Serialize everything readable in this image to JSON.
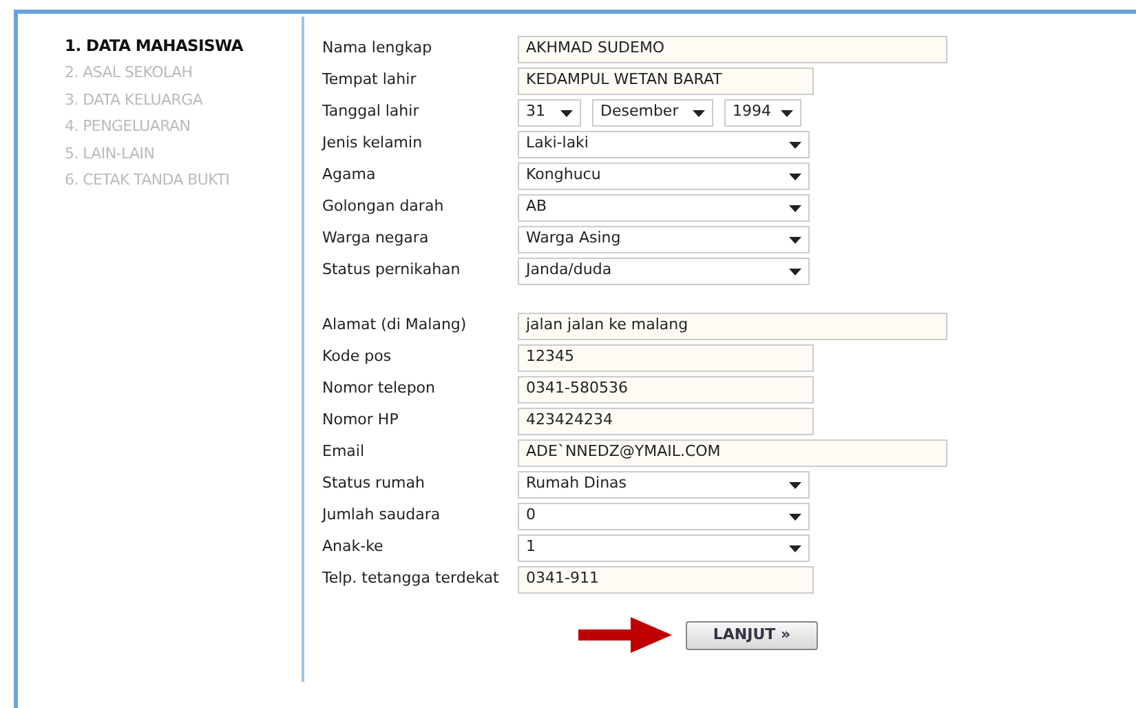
{
  "steps": [
    {
      "label": "1. DATA MAHASISWA",
      "selected": true
    },
    {
      "label": "2. ASAL SEKOLAH",
      "selected": false
    },
    {
      "label": "3. DATA KELUARGA",
      "selected": false
    },
    {
      "label": "4. PENGELUARAN",
      "selected": false
    },
    {
      "label": "5. LAIN-LAIN",
      "selected": false
    },
    {
      "label": "6. CETAK TANDA BUKTI",
      "selected": false
    }
  ],
  "form_groups": [
    [
      {
        "label": "Nama lengkap",
        "kind": "text-long",
        "value": "AKHMAD SUDEMO"
      },
      {
        "label": "Tempat lahir",
        "kind": "text",
        "value": "KEDAMPUL WETAN BARAT"
      },
      {
        "label": "Tanggal lahir",
        "kind": "date",
        "parts": [
          "31",
          "Desember",
          "1994"
        ]
      },
      {
        "label": "Jenis kelamin",
        "kind": "select",
        "value": "Laki-laki"
      },
      {
        "label": "Agama",
        "kind": "select",
        "value": "Konghucu"
      },
      {
        "label": "Golongan darah",
        "kind": "select",
        "value": "AB"
      },
      {
        "label": "Warga negara",
        "kind": "select",
        "value": "Warga Asing"
      },
      {
        "label": "Status pernikahan",
        "kind": "select",
        "value": "Janda/duda"
      }
    ],
    [
      {
        "label": "Alamat (di Malang)",
        "kind": "text-long",
        "value": "jalan jalan ke malang"
      },
      {
        "label": "Kode pos",
        "kind": "text",
        "value": "12345"
      },
      {
        "label": "Nomor telepon",
        "kind": "text",
        "value": "0341-580536"
      },
      {
        "label": "Nomor HP",
        "kind": "text",
        "value": "423424234"
      },
      {
        "label": "Email",
        "kind": "text-long",
        "value": "ADE`NNEDZ@YMAIL.COM"
      },
      {
        "label": "Status rumah",
        "kind": "select",
        "value": "Rumah Dinas"
      },
      {
        "label": "Jumlah saudara",
        "kind": "select",
        "value": "0"
      },
      {
        "label": "Anak-ke",
        "kind": "select",
        "value": "1"
      },
      {
        "label": "Telp. tetangga terdekat",
        "kind": "text",
        "value": "0341-911"
      }
    ]
  ],
  "next_button": "LANJUT »"
}
